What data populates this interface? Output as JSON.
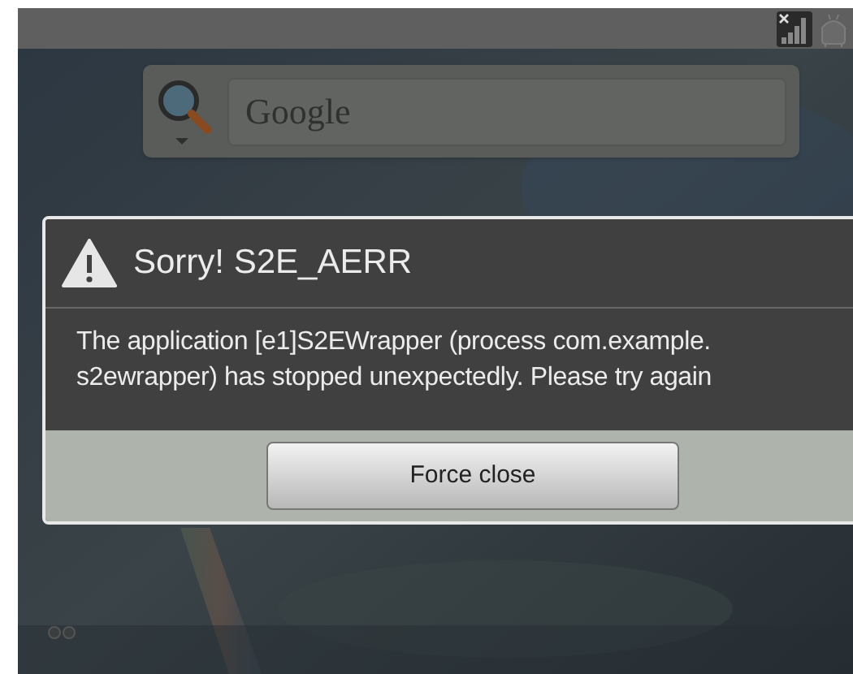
{
  "search": {
    "placeholder": "Google"
  },
  "dialog": {
    "title": "Sorry! S2E_AERR",
    "message": "The application [e1]S2EWrapper (process com.example.\ns2ewrapper) has stopped unexpectedly. Please try again",
    "buttons": [
      {
        "label": "Force close"
      }
    ]
  }
}
